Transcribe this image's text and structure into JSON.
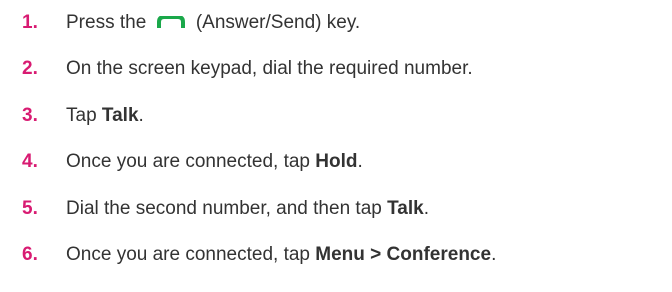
{
  "steps": [
    {
      "number": "1.",
      "parts": {
        "before": "Press the",
        "after": "(Answer/Send) key."
      },
      "icon": "send-key-icon",
      "icon_color": "#1aa84a"
    },
    {
      "number": "2.",
      "text": "On the screen keypad, dial the required number."
    },
    {
      "number": "3.",
      "before": "Tap ",
      "bold": "Talk",
      "after": "."
    },
    {
      "number": "4.",
      "before": "Once you are connected, tap ",
      "bold": "Hold",
      "after": "."
    },
    {
      "number": "5.",
      "before": "Dial the second number, and then tap ",
      "bold": "Talk",
      "after": "."
    },
    {
      "number": "6.",
      "before": "Once you are connected, tap ",
      "bold": "Menu > Conference",
      "after": "."
    }
  ],
  "colors": {
    "step_number": "#d81b72",
    "body_text": "#333333"
  }
}
